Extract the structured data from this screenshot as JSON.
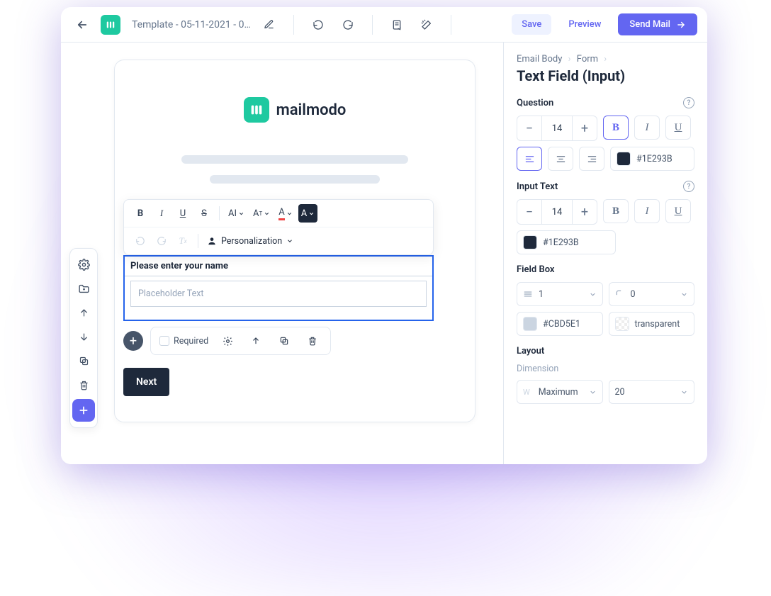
{
  "topbar": {
    "template_name": "Template - 05-11-2021 - 0…",
    "save": "Save",
    "preview": "Preview",
    "send_mail": "Send Mail"
  },
  "canvas": {
    "brand_name": "mailmodo",
    "toolbar": {
      "personalization": "Personalization"
    },
    "field": {
      "question": "Please enter your name",
      "placeholder": "Placeholder Text",
      "required": "Required"
    },
    "next": "Next"
  },
  "panel": {
    "crumbs": {
      "a": "Email Body",
      "b": "Form"
    },
    "title": "Text Field (Input)",
    "question": {
      "label": "Question",
      "font_size": "14",
      "color_hex": "#1E293B",
      "color_value": "#1E293B"
    },
    "input_text": {
      "label": "Input Text",
      "font_size": "14",
      "color_hex": "#1E293B",
      "color_value": "#1E293B"
    },
    "field_box": {
      "label": "Field Box",
      "border_width": "1",
      "border_radius": "0",
      "fill_hex": "#CBD5E1",
      "fill_value": "#CBD5E1",
      "bg_label": "transparent",
      "bg_value": "transparent"
    },
    "layout": {
      "label": "Layout",
      "dimension_label": "Dimension",
      "width_mode": "Maximum",
      "height": "20"
    }
  }
}
